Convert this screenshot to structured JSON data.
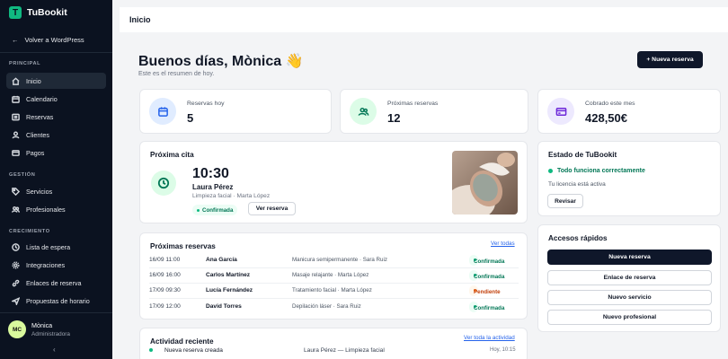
{
  "app": {
    "name": "TuBookit"
  },
  "sidebar": {
    "back_label": "Volver a WordPress",
    "sections": {
      "principal": "PRINCIPAL",
      "gestion": "GESTIÓN",
      "crecimiento": "CRECIMIENTO"
    },
    "items": [
      {
        "label": "Inicio",
        "icon": "home-icon"
      },
      {
        "label": "Calendario",
        "icon": "calendar-icon"
      },
      {
        "label": "Reservas",
        "icon": "list-icon"
      },
      {
        "label": "Clientes",
        "icon": "users-icon"
      },
      {
        "label": "Pagos",
        "icon": "card-icon"
      },
      {
        "label": "Servicios",
        "icon": "tag-icon"
      },
      {
        "label": "Profesionales",
        "icon": "user-group-icon"
      },
      {
        "label": "Lista de espera",
        "icon": "clock-icon"
      },
      {
        "label": "Integraciones",
        "icon": "gear-icon"
      },
      {
        "label": "Enlaces de reserva",
        "icon": "link-icon"
      },
      {
        "label": "Propuestas de horario",
        "icon": "send-icon"
      }
    ],
    "user": {
      "initials": "MC",
      "name": "Mònica",
      "role": "Administradora"
    },
    "collapse": "‹"
  },
  "topbar": {
    "title": "Inicio"
  },
  "header": {
    "greeting": "Buenos días, Mònica 👋",
    "subtitle": "Este es el resumen de hoy.",
    "new_button": "+ Nueva reserva"
  },
  "stats": [
    {
      "label": "Reservas hoy",
      "value": "5"
    },
    {
      "label": "Próximas reservas",
      "value": "12"
    },
    {
      "label": "Cobrado este mes",
      "value": "428,50€"
    }
  ],
  "next": {
    "title": "Próxima cita",
    "time": "10:30",
    "client": "Laura Pérez",
    "service": "Limpieza facial  ·  Marta López",
    "status": "Confirmada",
    "button": "Ver reserva"
  },
  "upcoming": {
    "title": "Próximas reservas",
    "link": "Ver todas",
    "rows": [
      {
        "datetime": "16/09 11:00",
        "client": "Ana García",
        "service": "Manicura semipermanente  ·  Sara Ruiz",
        "status": "Confirmada",
        "kind": "green"
      },
      {
        "datetime": "16/09 16:00",
        "client": "Carlos Martínez",
        "service": "Masaje relajante  ·  Marta López",
        "status": "Confirmada",
        "kind": "green"
      },
      {
        "datetime": "17/09 09:30",
        "client": "Lucía Fernández",
        "service": "Tratamiento facial  ·  Marta López",
        "status": "Pendiente",
        "kind": "orange"
      },
      {
        "datetime": "17/09 12:00",
        "client": "David Torres",
        "service": "Depilación láser  ·  Sara Ruiz",
        "status": "Confirmada",
        "kind": "green"
      }
    ]
  },
  "activity": {
    "title": "Actividad reciente",
    "link": "Ver toda la actividad",
    "rows": [
      {
        "event": "Nueva reserva creada",
        "detail": "Laura Pérez — Limpieza facial",
        "time": "Hoy, 10:15"
      }
    ]
  },
  "status_card": {
    "title": "Estado de TuBookit",
    "status": "Todo funciona correctamente",
    "license": "Tu licencia está activa",
    "button": "Revisar"
  },
  "quick": {
    "title": "Accesos rápidos",
    "buttons": [
      "Nueva reserva",
      "Enlace de reserva",
      "Nuevo servicio",
      "Nuevo profesional"
    ]
  },
  "colors": {
    "accent": "#10b981",
    "dark": "#0f172a",
    "link": "#2563eb",
    "pending": "#f97316"
  }
}
